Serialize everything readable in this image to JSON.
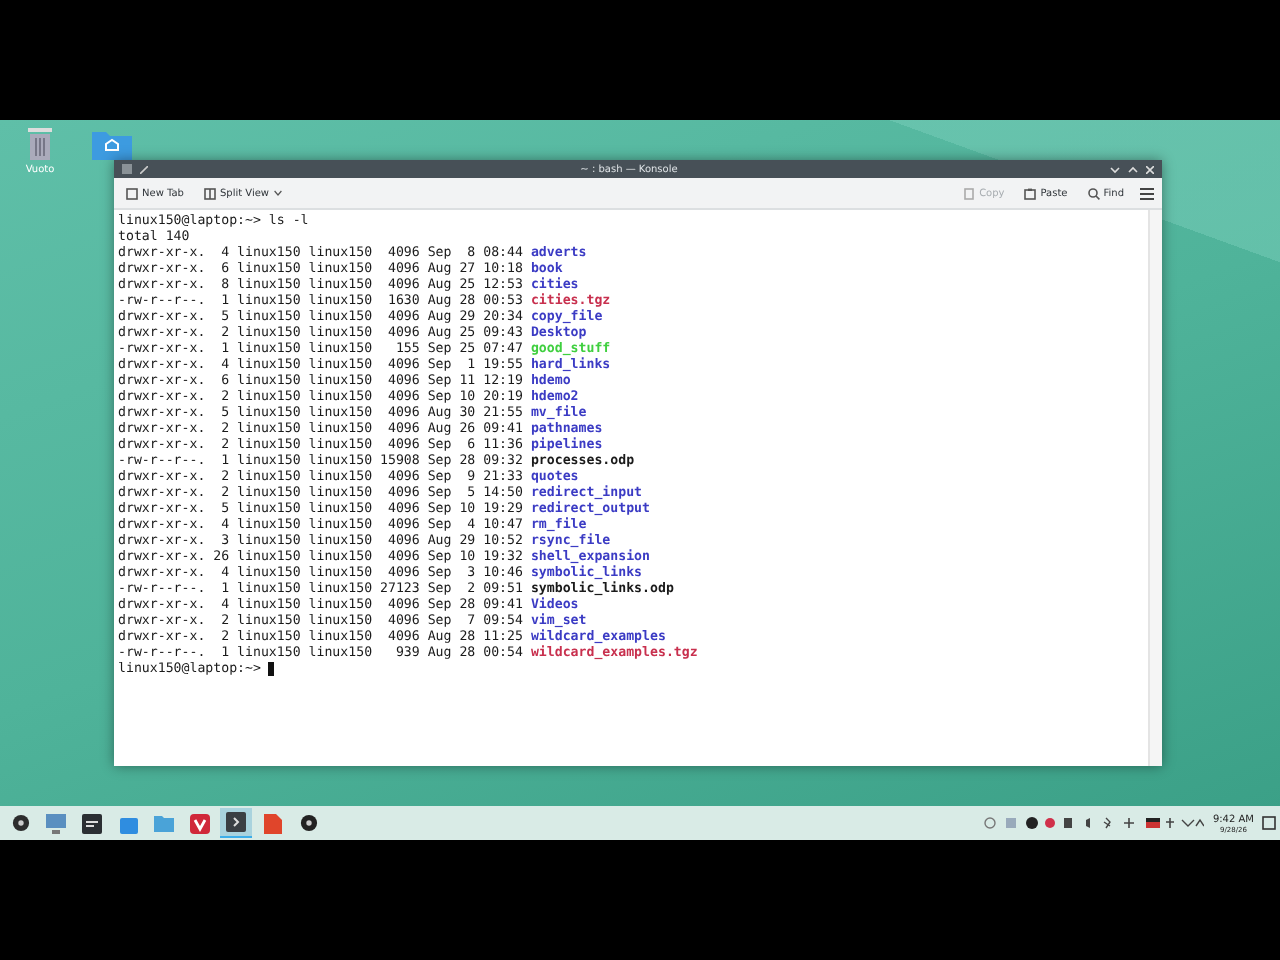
{
  "desktop_icons": [
    {
      "label": "Vuoto",
      "kind": "trash"
    },
    {
      "kind": "folder"
    }
  ],
  "window": {
    "title": "~ : bash — Konsole"
  },
  "toolbar": {
    "left": [
      {
        "label": "New Tab",
        "kind": "newtab",
        "disabled": false
      },
      {
        "label": "Split View",
        "kind": "split",
        "disabled": false
      }
    ],
    "right": [
      {
        "label": "Copy",
        "kind": "copy",
        "disabled": true
      },
      {
        "label": "Paste",
        "kind": "paste",
        "disabled": false
      },
      {
        "label": "Find",
        "kind": "find",
        "disabled": false
      }
    ]
  },
  "terminal": {
    "command_line": "linux150@laptop:~> ls -l",
    "total": "total 140",
    "entries": [
      {
        "info": "drwxr-xr-x.  4 linux150 linux150  4096 Sep  8 08:44",
        "name": "adverts",
        "kind": "dir"
      },
      {
        "info": "drwxr-xr-x.  6 linux150 linux150  4096 Aug 27 10:18",
        "name": "book",
        "kind": "dir"
      },
      {
        "info": "drwxr-xr-x.  8 linux150 linux150  4096 Aug 25 12:53",
        "name": "cities",
        "kind": "dir"
      },
      {
        "info": "-rw-r--r--.  1 linux150 linux150  1630 Aug 28 00:53",
        "name": "cities.tgz",
        "kind": "archive"
      },
      {
        "info": "drwxr-xr-x.  5 linux150 linux150  4096 Aug 29 20:34",
        "name": "copy_file",
        "kind": "dir"
      },
      {
        "info": "drwxr-xr-x.  2 linux150 linux150  4096 Aug 25 09:43",
        "name": "Desktop",
        "kind": "dir"
      },
      {
        "info": "-rwxr-xr-x.  1 linux150 linux150   155 Sep 25 07:47",
        "name": "good_stuff",
        "kind": "exec"
      },
      {
        "info": "drwxr-xr-x.  4 linux150 linux150  4096 Sep  1 19:55",
        "name": "hard_links",
        "kind": "dir"
      },
      {
        "info": "drwxr-xr-x.  6 linux150 linux150  4096 Sep 11 12:19",
        "name": "hdemo",
        "kind": "dir"
      },
      {
        "info": "drwxr-xr-x.  2 linux150 linux150  4096 Sep 10 20:19",
        "name": "hdemo2",
        "kind": "dir"
      },
      {
        "info": "drwxr-xr-x.  5 linux150 linux150  4096 Aug 30 21:55",
        "name": "mv_file",
        "kind": "dir"
      },
      {
        "info": "drwxr-xr-x.  2 linux150 linux150  4096 Aug 26 09:41",
        "name": "pathnames",
        "kind": "dir"
      },
      {
        "info": "drwxr-xr-x.  2 linux150 linux150  4096 Sep  6 11:36",
        "name": "pipelines",
        "kind": "dir"
      },
      {
        "info": "-rw-r--r--.  1 linux150 linux150 15908 Sep 28 09:32",
        "name": "processes.odp",
        "kind": "file"
      },
      {
        "info": "drwxr-xr-x.  2 linux150 linux150  4096 Sep  9 21:33",
        "name": "quotes",
        "kind": "dir"
      },
      {
        "info": "drwxr-xr-x.  2 linux150 linux150  4096 Sep  5 14:50",
        "name": "redirect_input",
        "kind": "dir"
      },
      {
        "info": "drwxr-xr-x.  5 linux150 linux150  4096 Sep 10 19:29",
        "name": "redirect_output",
        "kind": "dir"
      },
      {
        "info": "drwxr-xr-x.  4 linux150 linux150  4096 Sep  4 10:47",
        "name": "rm_file",
        "kind": "dir"
      },
      {
        "info": "drwxr-xr-x.  3 linux150 linux150  4096 Aug 29 10:52",
        "name": "rsync_file",
        "kind": "dir"
      },
      {
        "info": "drwxr-xr-x. 26 linux150 linux150  4096 Sep 10 19:32",
        "name": "shell_expansion",
        "kind": "dir"
      },
      {
        "info": "drwxr-xr-x.  4 linux150 linux150  4096 Sep  3 10:46",
        "name": "symbolic_links",
        "kind": "dir"
      },
      {
        "info": "-rw-r--r--.  1 linux150 linux150 27123 Sep  2 09:51",
        "name": "symbolic_links.odp",
        "kind": "file"
      },
      {
        "info": "drwxr-xr-x.  4 linux150 linux150  4096 Sep 28 09:41",
        "name": "Videos",
        "kind": "dir"
      },
      {
        "info": "drwxr-xr-x.  2 linux150 linux150  4096 Sep  7 09:54",
        "name": "vim_set",
        "kind": "dir"
      },
      {
        "info": "drwxr-xr-x.  2 linux150 linux150  4096 Aug 28 11:25",
        "name": "wildcard_examples",
        "kind": "dir"
      },
      {
        "info": "-rw-r--r--.  1 linux150 linux150   939 Aug 28 00:54",
        "name": "wildcard_examples.tgz",
        "kind": "archive"
      }
    ],
    "prompt": "linux150@laptop:~>"
  },
  "taskbar": {
    "apps": [
      {
        "kind": "start",
        "selected": false
      },
      {
        "kind": "desktop",
        "selected": false
      },
      {
        "kind": "terminal",
        "selected": false
      },
      {
        "kind": "store",
        "selected": false
      },
      {
        "kind": "files",
        "selected": false
      },
      {
        "kind": "browser",
        "selected": false
      },
      {
        "kind": "konsole",
        "selected": true
      },
      {
        "kind": "office",
        "selected": false
      },
      {
        "kind": "media",
        "selected": false
      }
    ],
    "time": "9:42 AM",
    "date": "9/28/26"
  }
}
